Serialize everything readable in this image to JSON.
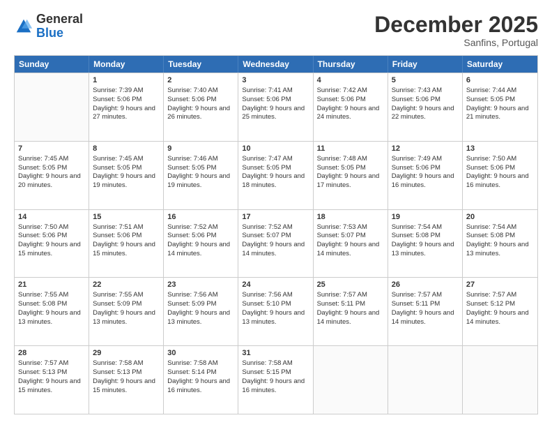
{
  "header": {
    "logo_general": "General",
    "logo_blue": "Blue",
    "month_title": "December 2025",
    "location": "Sanfins, Portugal"
  },
  "days_of_week": [
    "Sunday",
    "Monday",
    "Tuesday",
    "Wednesday",
    "Thursday",
    "Friday",
    "Saturday"
  ],
  "weeks": [
    [
      {
        "day": "",
        "empty": true
      },
      {
        "day": "1",
        "sunrise": "Sunrise: 7:39 AM",
        "sunset": "Sunset: 5:06 PM",
        "daylight": "Daylight: 9 hours and 27 minutes."
      },
      {
        "day": "2",
        "sunrise": "Sunrise: 7:40 AM",
        "sunset": "Sunset: 5:06 PM",
        "daylight": "Daylight: 9 hours and 26 minutes."
      },
      {
        "day": "3",
        "sunrise": "Sunrise: 7:41 AM",
        "sunset": "Sunset: 5:06 PM",
        "daylight": "Daylight: 9 hours and 25 minutes."
      },
      {
        "day": "4",
        "sunrise": "Sunrise: 7:42 AM",
        "sunset": "Sunset: 5:06 PM",
        "daylight": "Daylight: 9 hours and 24 minutes."
      },
      {
        "day": "5",
        "sunrise": "Sunrise: 7:43 AM",
        "sunset": "Sunset: 5:06 PM",
        "daylight": "Daylight: 9 hours and 22 minutes."
      },
      {
        "day": "6",
        "sunrise": "Sunrise: 7:44 AM",
        "sunset": "Sunset: 5:05 PM",
        "daylight": "Daylight: 9 hours and 21 minutes."
      }
    ],
    [
      {
        "day": "7",
        "sunrise": "Sunrise: 7:45 AM",
        "sunset": "Sunset: 5:05 PM",
        "daylight": "Daylight: 9 hours and 20 minutes."
      },
      {
        "day": "8",
        "sunrise": "Sunrise: 7:45 AM",
        "sunset": "Sunset: 5:05 PM",
        "daylight": "Daylight: 9 hours and 19 minutes."
      },
      {
        "day": "9",
        "sunrise": "Sunrise: 7:46 AM",
        "sunset": "Sunset: 5:05 PM",
        "daylight": "Daylight: 9 hours and 19 minutes."
      },
      {
        "day": "10",
        "sunrise": "Sunrise: 7:47 AM",
        "sunset": "Sunset: 5:05 PM",
        "daylight": "Daylight: 9 hours and 18 minutes."
      },
      {
        "day": "11",
        "sunrise": "Sunrise: 7:48 AM",
        "sunset": "Sunset: 5:05 PM",
        "daylight": "Daylight: 9 hours and 17 minutes."
      },
      {
        "day": "12",
        "sunrise": "Sunrise: 7:49 AM",
        "sunset": "Sunset: 5:06 PM",
        "daylight": "Daylight: 9 hours and 16 minutes."
      },
      {
        "day": "13",
        "sunrise": "Sunrise: 7:50 AM",
        "sunset": "Sunset: 5:06 PM",
        "daylight": "Daylight: 9 hours and 16 minutes."
      }
    ],
    [
      {
        "day": "14",
        "sunrise": "Sunrise: 7:50 AM",
        "sunset": "Sunset: 5:06 PM",
        "daylight": "Daylight: 9 hours and 15 minutes."
      },
      {
        "day": "15",
        "sunrise": "Sunrise: 7:51 AM",
        "sunset": "Sunset: 5:06 PM",
        "daylight": "Daylight: 9 hours and 15 minutes."
      },
      {
        "day": "16",
        "sunrise": "Sunrise: 7:52 AM",
        "sunset": "Sunset: 5:06 PM",
        "daylight": "Daylight: 9 hours and 14 minutes."
      },
      {
        "day": "17",
        "sunrise": "Sunrise: 7:52 AM",
        "sunset": "Sunset: 5:07 PM",
        "daylight": "Daylight: 9 hours and 14 minutes."
      },
      {
        "day": "18",
        "sunrise": "Sunrise: 7:53 AM",
        "sunset": "Sunset: 5:07 PM",
        "daylight": "Daylight: 9 hours and 14 minutes."
      },
      {
        "day": "19",
        "sunrise": "Sunrise: 7:54 AM",
        "sunset": "Sunset: 5:08 PM",
        "daylight": "Daylight: 9 hours and 13 minutes."
      },
      {
        "day": "20",
        "sunrise": "Sunrise: 7:54 AM",
        "sunset": "Sunset: 5:08 PM",
        "daylight": "Daylight: 9 hours and 13 minutes."
      }
    ],
    [
      {
        "day": "21",
        "sunrise": "Sunrise: 7:55 AM",
        "sunset": "Sunset: 5:08 PM",
        "daylight": "Daylight: 9 hours and 13 minutes."
      },
      {
        "day": "22",
        "sunrise": "Sunrise: 7:55 AM",
        "sunset": "Sunset: 5:09 PM",
        "daylight": "Daylight: 9 hours and 13 minutes."
      },
      {
        "day": "23",
        "sunrise": "Sunrise: 7:56 AM",
        "sunset": "Sunset: 5:09 PM",
        "daylight": "Daylight: 9 hours and 13 minutes."
      },
      {
        "day": "24",
        "sunrise": "Sunrise: 7:56 AM",
        "sunset": "Sunset: 5:10 PM",
        "daylight": "Daylight: 9 hours and 13 minutes."
      },
      {
        "day": "25",
        "sunrise": "Sunrise: 7:57 AM",
        "sunset": "Sunset: 5:11 PM",
        "daylight": "Daylight: 9 hours and 14 minutes."
      },
      {
        "day": "26",
        "sunrise": "Sunrise: 7:57 AM",
        "sunset": "Sunset: 5:11 PM",
        "daylight": "Daylight: 9 hours and 14 minutes."
      },
      {
        "day": "27",
        "sunrise": "Sunrise: 7:57 AM",
        "sunset": "Sunset: 5:12 PM",
        "daylight": "Daylight: 9 hours and 14 minutes."
      }
    ],
    [
      {
        "day": "28",
        "sunrise": "Sunrise: 7:57 AM",
        "sunset": "Sunset: 5:13 PM",
        "daylight": "Daylight: 9 hours and 15 minutes."
      },
      {
        "day": "29",
        "sunrise": "Sunrise: 7:58 AM",
        "sunset": "Sunset: 5:13 PM",
        "daylight": "Daylight: 9 hours and 15 minutes."
      },
      {
        "day": "30",
        "sunrise": "Sunrise: 7:58 AM",
        "sunset": "Sunset: 5:14 PM",
        "daylight": "Daylight: 9 hours and 16 minutes."
      },
      {
        "day": "31",
        "sunrise": "Sunrise: 7:58 AM",
        "sunset": "Sunset: 5:15 PM",
        "daylight": "Daylight: 9 hours and 16 minutes."
      },
      {
        "day": "",
        "empty": true
      },
      {
        "day": "",
        "empty": true
      },
      {
        "day": "",
        "empty": true
      }
    ]
  ]
}
